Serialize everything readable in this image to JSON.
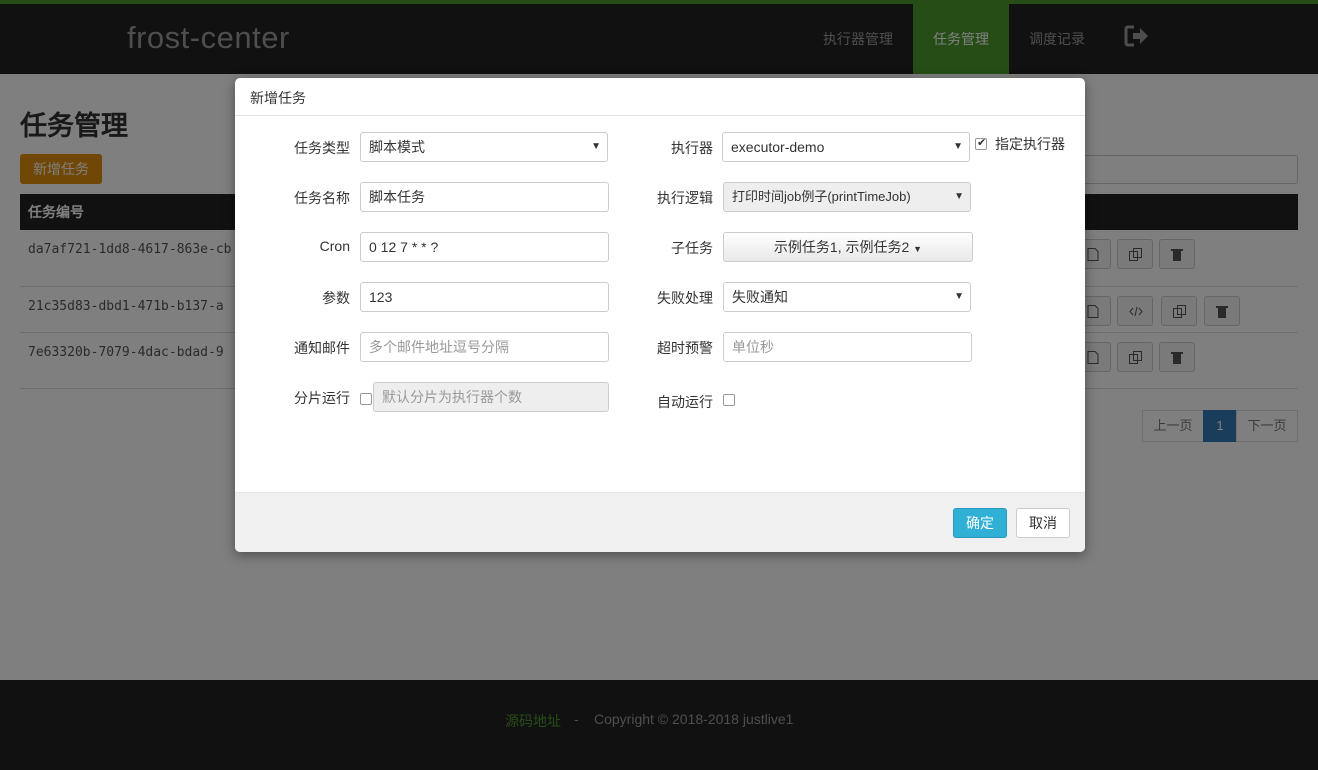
{
  "navbar": {
    "brand": "frost-center",
    "items": [
      "执行器管理",
      "任务管理",
      "调度记录"
    ],
    "active_item": "任务管理",
    "logout_icon": "sign-out-icon",
    "accent_color": "#4f9a2f"
  },
  "page": {
    "title": "任务管理",
    "add_button": "新增任务",
    "table": {
      "header": "任务编号",
      "rows": [
        "da7af721-1dd8-4617-863e-cb",
        "21c35d83-dbd1-471b-b137-a",
        "7e63320b-7079-4dac-bdad-9"
      ]
    },
    "pagination": {
      "prev": "上一页",
      "current": "1",
      "next": "下一页"
    }
  },
  "footer": {
    "source_link": "源码地址",
    "separator": "-",
    "copyright": "Copyright © 2018-2018 justlive1"
  },
  "modal": {
    "title": "新增任务",
    "fields": {
      "task_type": {
        "label": "任务类型",
        "value": "脚本模式"
      },
      "task_name": {
        "label": "任务名称",
        "value": "脚本任务"
      },
      "cron": {
        "label": "Cron",
        "value": "0 12 7 * * ?"
      },
      "params": {
        "label": "参数",
        "value": "123"
      },
      "notify_email": {
        "label": "通知邮件",
        "placeholder": "多个邮件地址逗号分隔"
      },
      "sharding": {
        "label": "分片运行",
        "placeholder": "默认分片为执行器个数",
        "checked": false
      },
      "executor": {
        "label": "执行器",
        "value": "executor-demo"
      },
      "specify_executor": {
        "label": "指定执行器",
        "checked": true
      },
      "exec_logic": {
        "label": "执行逻辑",
        "value": "打印时间job例子(printTimeJob)"
      },
      "child_tasks": {
        "label": "子任务",
        "value": "示例任务1, 示例任务2"
      },
      "failure": {
        "label": "失败处理",
        "value": "失败通知"
      },
      "timeout": {
        "label": "超时预警",
        "placeholder": "单位秒"
      },
      "auto_run": {
        "label": "自动运行",
        "checked": false
      }
    },
    "ok_button": "确定",
    "cancel_button": "取消"
  }
}
